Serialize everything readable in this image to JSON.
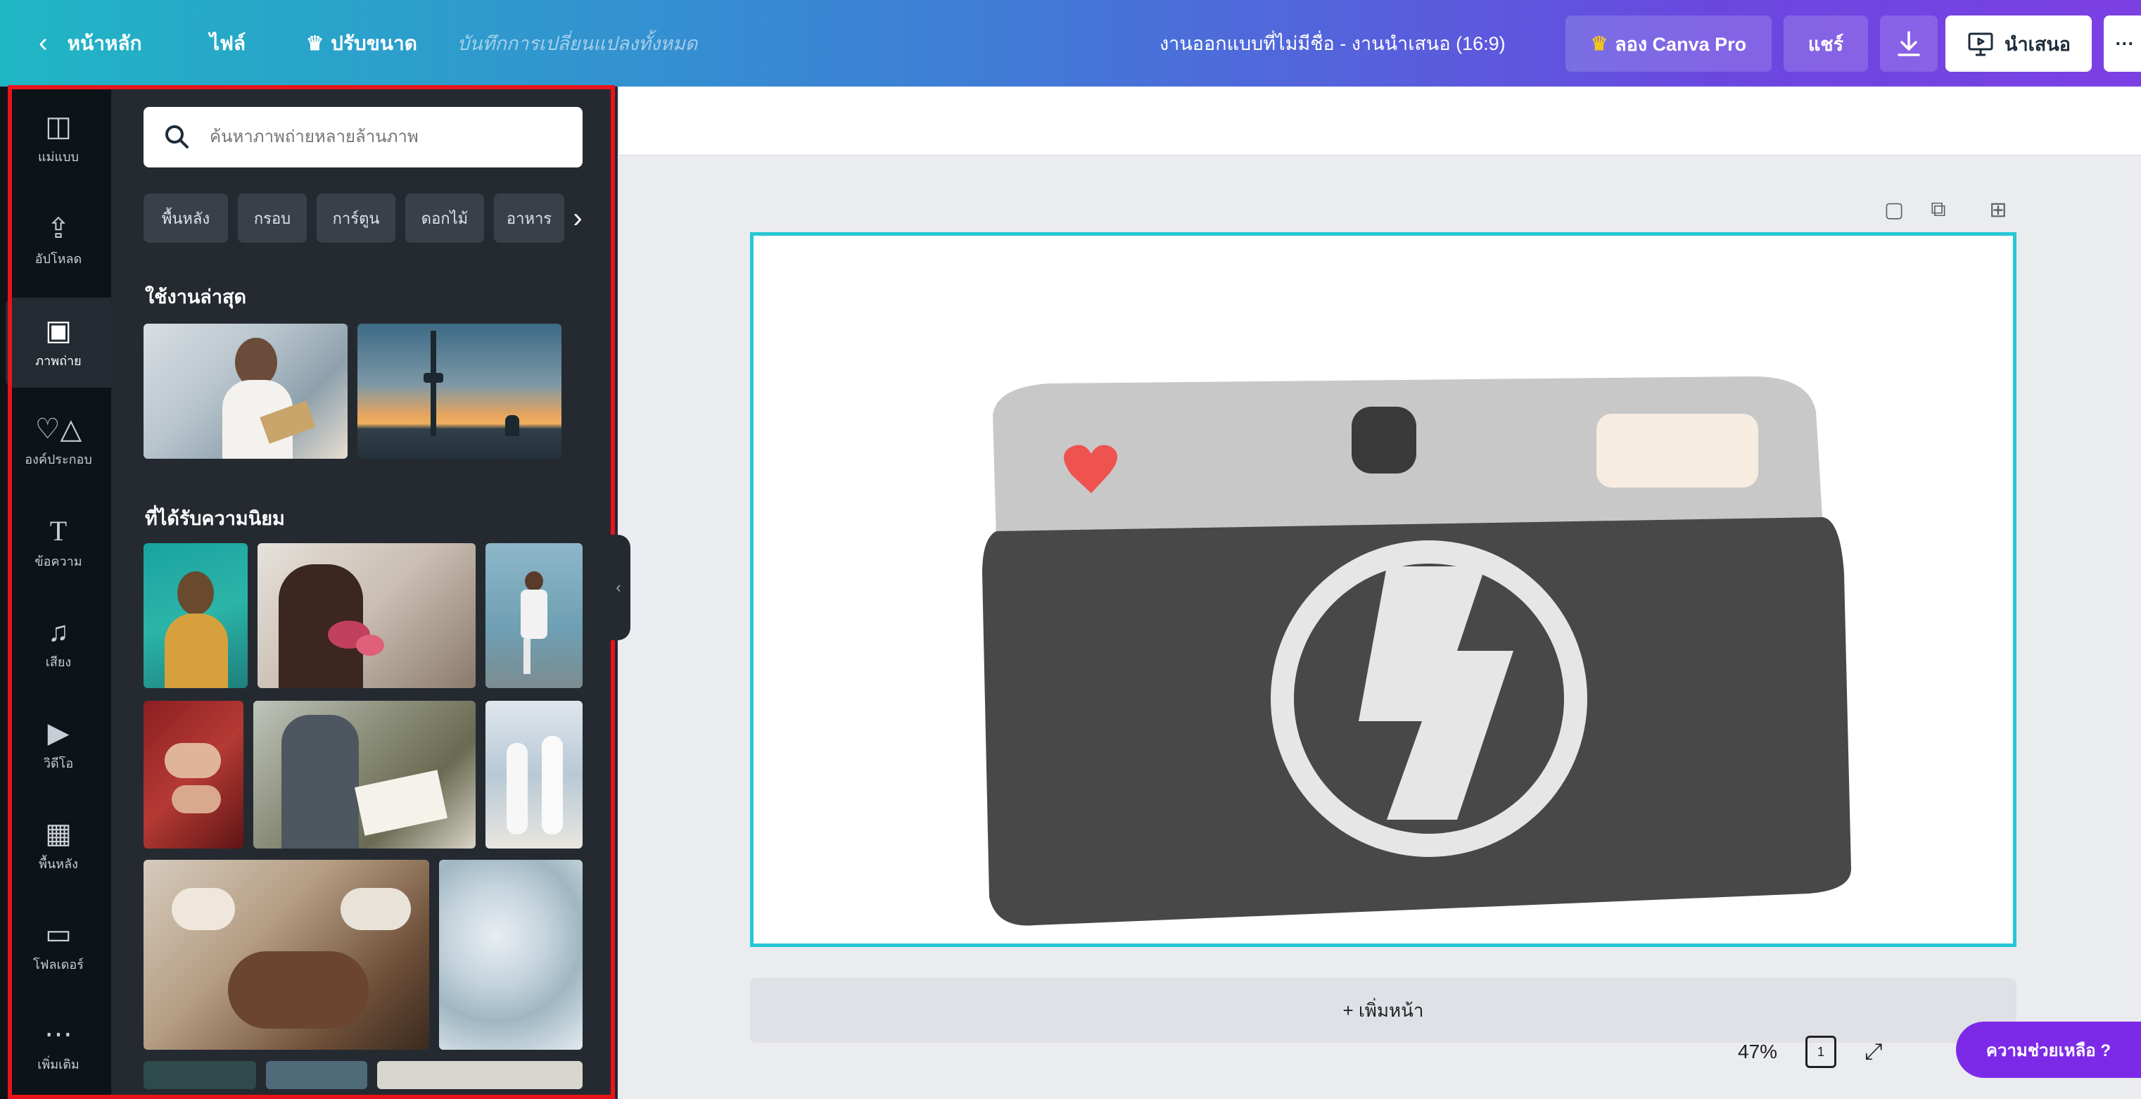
{
  "topbar": {
    "back_label": "หน้าหลัก",
    "file_label": "ไฟล์",
    "resize_label": "ปรับขนาด",
    "save_status": "บันทึกการเปลี่ยนแปลงทั้งหมด",
    "doc_title": "งานออกแบบที่ไม่มีชื่อ - งานนำเสนอ (16:9)",
    "try_pro_label": "ลอง Canva Pro",
    "share_label": "แชร์",
    "present_label": "นำเสนอ",
    "more_label": "···",
    "crown_color": "#f5c518"
  },
  "rail": {
    "items": [
      {
        "label": "แม่แบบ",
        "icon": "template-icon"
      },
      {
        "label": "อัปโหลด",
        "icon": "upload-icon"
      },
      {
        "label": "ภาพถ่าย",
        "icon": "photo-icon"
      },
      {
        "label": "องค์ประกอบ",
        "icon": "elements-icon"
      },
      {
        "label": "ข้อความ",
        "icon": "text-icon"
      },
      {
        "label": "เสียง",
        "icon": "music-icon"
      },
      {
        "label": "วิดีโอ",
        "icon": "video-icon"
      },
      {
        "label": "พื้นหลัง",
        "icon": "background-icon"
      },
      {
        "label": "โฟลเดอร์",
        "icon": "folder-icon"
      },
      {
        "label": "เพิ่มเติม",
        "icon": "more-icon"
      }
    ]
  },
  "panel": {
    "search_placeholder": "ค้นหาภาพถ่ายหลายล้านภาพ",
    "chips": [
      "พื้นหลัง",
      "กรอบ",
      "การ์ตูน",
      "ดอกไม้",
      "อาหาร"
    ],
    "recent_title": "ใช้งานล่าสุด",
    "popular_title": "ที่ได้รับความนิยม"
  },
  "canvas": {
    "add_page_label": "+ เพิ่มหน้า",
    "zoom": "47%",
    "page_count": "1",
    "help_label": "ความช่วยเหลือ ?",
    "accent_color": "#25c7d5",
    "heart_color": "#ef5350"
  }
}
